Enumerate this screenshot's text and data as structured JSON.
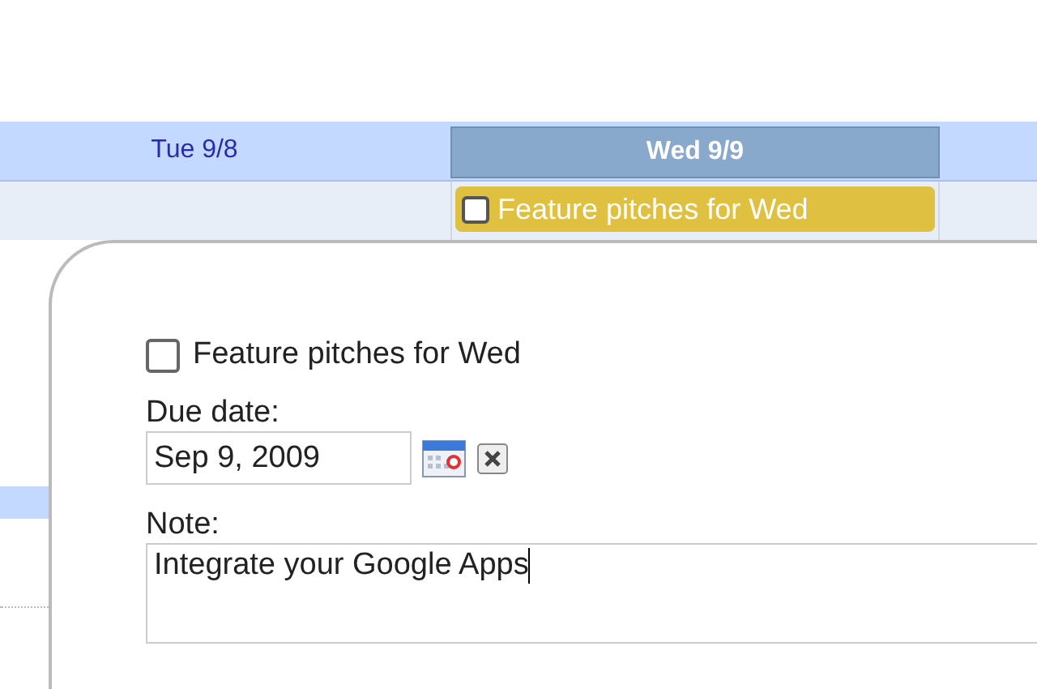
{
  "calendar": {
    "days": [
      {
        "label": "Tue 9/8",
        "selected": false
      },
      {
        "label": "Wed 9/9",
        "selected": true
      }
    ],
    "task_chip": {
      "title": "Feature pitches for Wed",
      "checked": false
    }
  },
  "task_popup": {
    "title": "Feature pitches for Wed",
    "checked": false,
    "due_date_label": "Due date:",
    "due_date": "Sep 9, 2009",
    "note_label": "Note:",
    "note": "Integrate your Google Apps"
  }
}
